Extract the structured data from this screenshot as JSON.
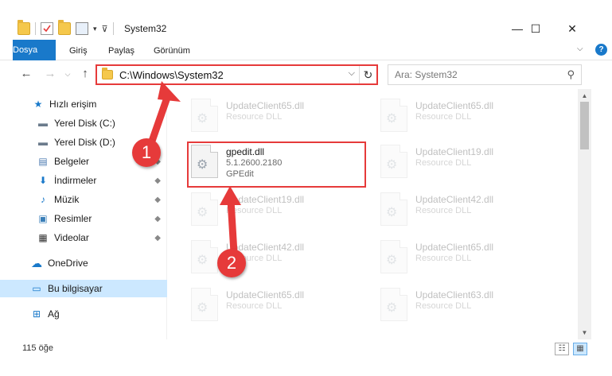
{
  "window": {
    "title": "System32",
    "minimize_glyph": "—",
    "maximize_glyph": "☐",
    "close_glyph": "✕"
  },
  "ribbon": {
    "tabs": [
      {
        "label": "Dosya"
      },
      {
        "label": "Giriş"
      },
      {
        "label": "Paylaş"
      },
      {
        "label": "Görünüm"
      }
    ],
    "help_glyph": "?",
    "expand_glyph": "⌵"
  },
  "addressbar": {
    "path": "C:\\Windows\\System32",
    "dropdown_glyph": "⌵",
    "refresh_glyph": "↻"
  },
  "search": {
    "placeholder": "Ara: System32",
    "icon_glyph": "⚲"
  },
  "nav": {
    "back_glyph": "←",
    "forward_glyph": "→",
    "history_glyph": "⌵",
    "up_glyph": "↑"
  },
  "sidebar": {
    "items": [
      {
        "label": "Hızlı erişim",
        "icon": "star-icon",
        "glyph": "★",
        "pinned": false
      },
      {
        "label": "Yerel Disk (C:)",
        "icon": "drive-icon",
        "glyph": "▬",
        "pinned": false
      },
      {
        "label": "Yerel Disk (D:)",
        "icon": "drive-icon",
        "glyph": "▬",
        "pinned": false
      },
      {
        "label": "Belgeler",
        "icon": "documents-icon",
        "glyph": "▤",
        "pinned": true
      },
      {
        "label": "İndirmeler",
        "icon": "downloads-icon",
        "glyph": "⬇",
        "pinned": true
      },
      {
        "label": "Müzik",
        "icon": "music-icon",
        "glyph": "♪",
        "pinned": true
      },
      {
        "label": "Resimler",
        "icon": "pictures-icon",
        "glyph": "▣",
        "pinned": true
      },
      {
        "label": "Videolar",
        "icon": "videos-icon",
        "glyph": "▦",
        "pinned": true
      },
      {
        "label": "OneDrive",
        "icon": "cloud-icon",
        "glyph": "☁",
        "pinned": false
      },
      {
        "label": "Bu bilgisayar",
        "icon": "computer-icon",
        "glyph": "▭",
        "pinned": false
      },
      {
        "label": "Ağ",
        "icon": "network-icon",
        "glyph": "⊞",
        "pinned": false
      }
    ],
    "pin_glyph": "📌"
  },
  "files": [
    {
      "name": "UpdateClient65.dll",
      "sub": "Resource DLL",
      "faded": true
    },
    {
      "name": "UpdateClient65.dll",
      "sub": "Resource DLL",
      "faded": true
    },
    {
      "name": "gpedit.dll",
      "sub": "5.1.2600.2180",
      "sub2": "GPEdit",
      "faded": false
    },
    {
      "name": "UpdateClient19.dll",
      "sub": "Resource DLL",
      "faded": true
    },
    {
      "name": "UpdateClient19.dll",
      "sub": "Resource DLL",
      "faded": true
    },
    {
      "name": "UpdateClient42.dll",
      "sub": "Resource DLL",
      "faded": true
    },
    {
      "name": "UpdateClient42.dll",
      "sub": "Resource DLL",
      "faded": true
    },
    {
      "name": "UpdateClient65.dll",
      "sub": "Resource DLL",
      "faded": true
    },
    {
      "name": "UpdateClient65.dll",
      "sub": "Resource DLL",
      "faded": true
    },
    {
      "name": "UpdateClient63.dll",
      "sub": "Resource DLL",
      "faded": true
    }
  ],
  "status": {
    "count": "115 öğe"
  },
  "annotations": {
    "badge1": "1",
    "badge2": "2",
    "color": "#e63a3a"
  }
}
